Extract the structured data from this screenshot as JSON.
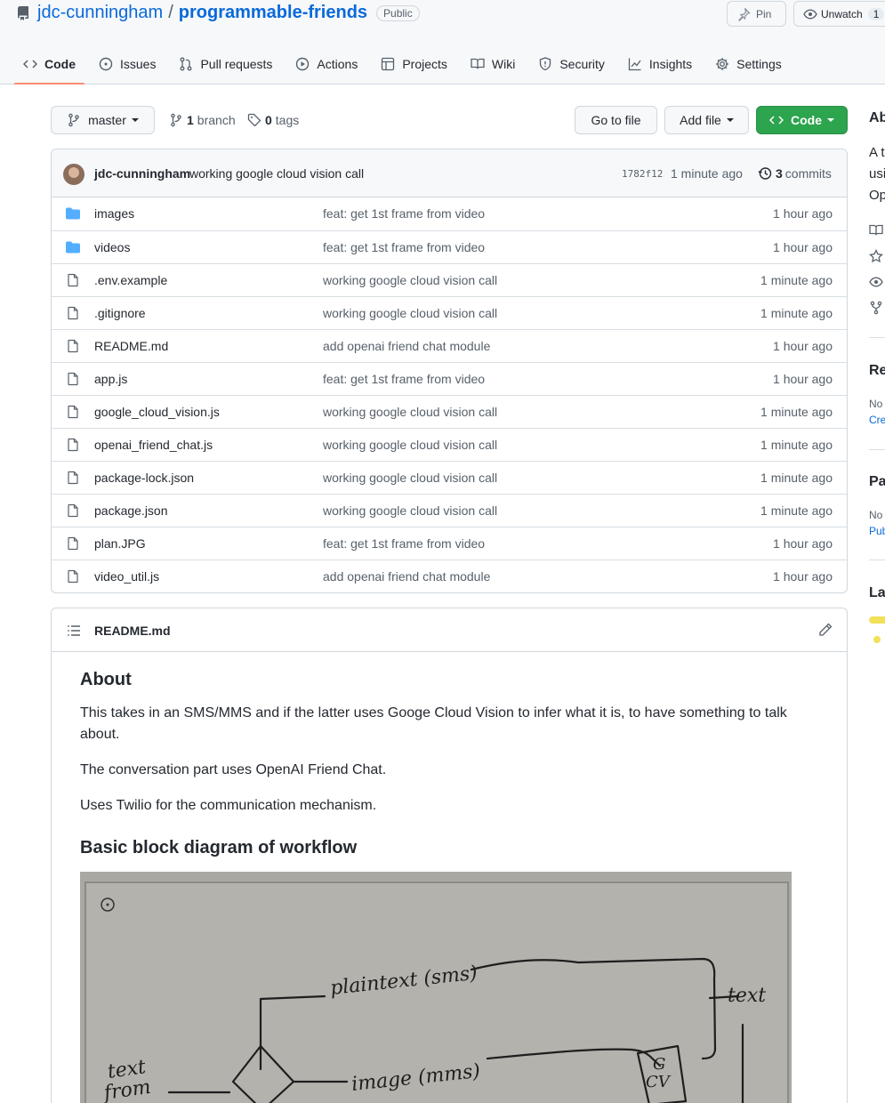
{
  "header": {
    "owner": "jdc-cunningham",
    "separator": "/",
    "repo": "programmable-friends",
    "visibility": "Public",
    "pin_label": "Pin",
    "watch_label": "Unwatch",
    "watch_count": "1"
  },
  "tabs": [
    {
      "label": "Code",
      "icon": "code-icon"
    },
    {
      "label": "Issues",
      "icon": "issue-icon"
    },
    {
      "label": "Pull requests",
      "icon": "pull-request-icon"
    },
    {
      "label": "Actions",
      "icon": "play-icon"
    },
    {
      "label": "Projects",
      "icon": "table-icon"
    },
    {
      "label": "Wiki",
      "icon": "book-icon"
    },
    {
      "label": "Security",
      "icon": "shield-icon"
    },
    {
      "label": "Insights",
      "icon": "graph-icon"
    },
    {
      "label": "Settings",
      "icon": "gear-icon"
    }
  ],
  "toolbar": {
    "branch": "master",
    "branch_count": "1",
    "branch_label": "branch",
    "tag_count": "0",
    "tag_label": "tags",
    "go_to_file": "Go to file",
    "add_file": "Add file",
    "code": "Code"
  },
  "latest_commit": {
    "author": "jdc-cunningham",
    "message": "working google cloud vision call",
    "sha": "1782f12",
    "time": "1 minute ago",
    "count": "3",
    "count_label": "commits"
  },
  "files": [
    {
      "name": "images",
      "type": "folder",
      "commit": "feat: get 1st frame from video",
      "age": "1 hour ago"
    },
    {
      "name": "videos",
      "type": "folder",
      "commit": "feat: get 1st frame from video",
      "age": "1 hour ago"
    },
    {
      "name": ".env.example",
      "type": "file",
      "commit": "working google cloud vision call",
      "age": "1 minute ago"
    },
    {
      "name": ".gitignore",
      "type": "file",
      "commit": "working google cloud vision call",
      "age": "1 minute ago"
    },
    {
      "name": "README.md",
      "type": "file",
      "commit": "add openai friend chat module",
      "age": "1 hour ago"
    },
    {
      "name": "app.js",
      "type": "file",
      "commit": "feat: get 1st frame from video",
      "age": "1 hour ago"
    },
    {
      "name": "google_cloud_vision.js",
      "type": "file",
      "commit": "working google cloud vision call",
      "age": "1 minute ago"
    },
    {
      "name": "openai_friend_chat.js",
      "type": "file",
      "commit": "working google cloud vision call",
      "age": "1 minute ago"
    },
    {
      "name": "package-lock.json",
      "type": "file",
      "commit": "working google cloud vision call",
      "age": "1 minute ago"
    },
    {
      "name": "package.json",
      "type": "file",
      "commit": "working google cloud vision call",
      "age": "1 minute ago"
    },
    {
      "name": "plan.JPG",
      "type": "file",
      "commit": "feat: get 1st frame from video",
      "age": "1 hour ago"
    },
    {
      "name": "video_util.js",
      "type": "file",
      "commit": "add openai friend chat module",
      "age": "1 hour ago"
    }
  ],
  "readme": {
    "filename": "README.md",
    "h_about": "About",
    "p1": "This takes in an SMS/MMS and if the latter uses Googe Cloud Vision to infer what it is, to have something to talk about.",
    "p2": "The conversation part uses OpenAI Friend Chat.",
    "p3": "Uses Twilio for the communication mechanism.",
    "h_diagram": "Basic block diagram of workflow",
    "sketch": {
      "label_plaintext": "plaintext (sms)",
      "label_text": "text",
      "label_image": "image (mms)",
      "label_text_from": "text",
      "label_from": "from",
      "label_gcv1": "G",
      "label_gcv2": "CV"
    }
  },
  "sidebar": {
    "about_h": "Ab",
    "about_l1": "A t",
    "about_l2": "usi",
    "about_l3": "Op",
    "releases_h": "Re",
    "releases_s": "No",
    "releases_a": "Cre",
    "packages_h": "Pa",
    "packages_s": "No",
    "packages_a": "Pub",
    "languages_h": "La",
    "language_color": "#f1e05a"
  },
  "colors": {
    "link": "#0969da",
    "primary_button": "#2da44e",
    "folder": "#54aeff",
    "tab_underline": "#fd8c73"
  }
}
